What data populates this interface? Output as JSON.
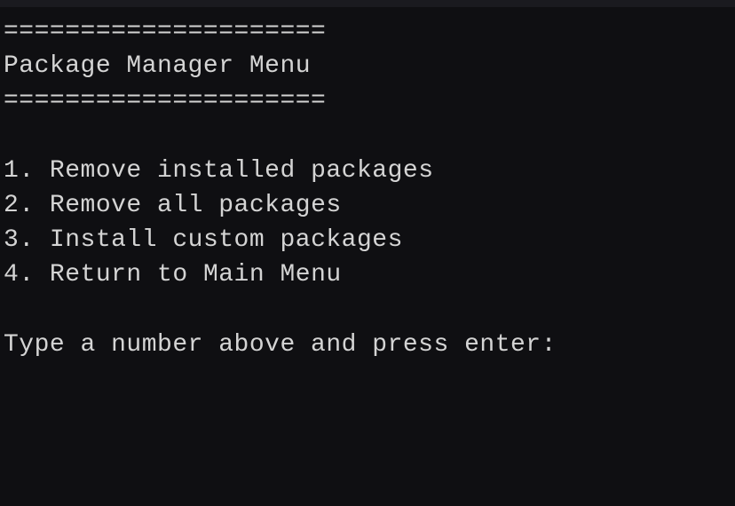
{
  "separator": "=====================",
  "title": "Package Manager Menu",
  "menu": {
    "items": [
      {
        "num": "1",
        "label": "Remove installed packages"
      },
      {
        "num": "2",
        "label": "Remove all packages"
      },
      {
        "num": "3",
        "label": "Install custom packages"
      },
      {
        "num": "4",
        "label": "Return to Main Menu"
      }
    ]
  },
  "prompt": "Type a number above and press enter:"
}
